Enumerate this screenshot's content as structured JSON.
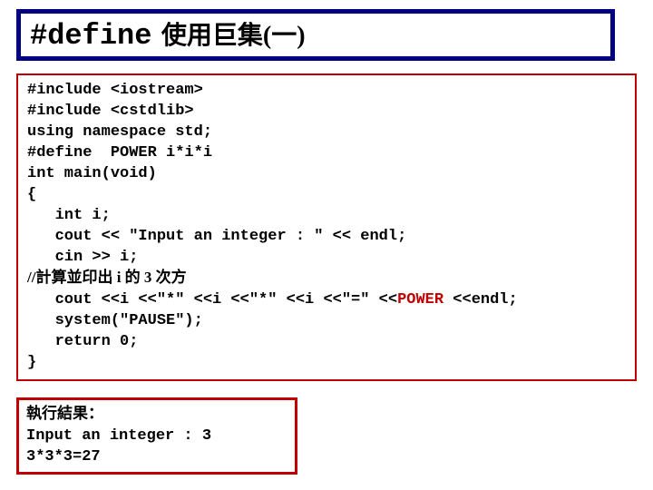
{
  "title": {
    "main": "#define",
    "sub": "使用巨集(一)"
  },
  "code": {
    "l01": "#include <iostream>",
    "l02": "#include <cstdlib>",
    "l03": "using namespace std;",
    "l04": "#define  POWER i*i*i",
    "l05": "int main(void)",
    "l06": "{",
    "l07": "   int i;",
    "l08": "   cout << \"Input an integer : \" << endl;",
    "l09": "   cin >> i;",
    "l10a": "//計算並印出 i 的 3 次方",
    "l11a": "   cout <<i <<\"*\" <<i <<\"*\" <<i <<\"=\" <<",
    "l11b": "POWER",
    "l11c": " <<endl;",
    "l12": "   system(\"PAUSE\");",
    "l13": "   return 0;",
    "l14": "}"
  },
  "result": {
    "label": "執行結果：",
    "out1": "Input an integer : 3",
    "out2": "3*3*3=27"
  }
}
